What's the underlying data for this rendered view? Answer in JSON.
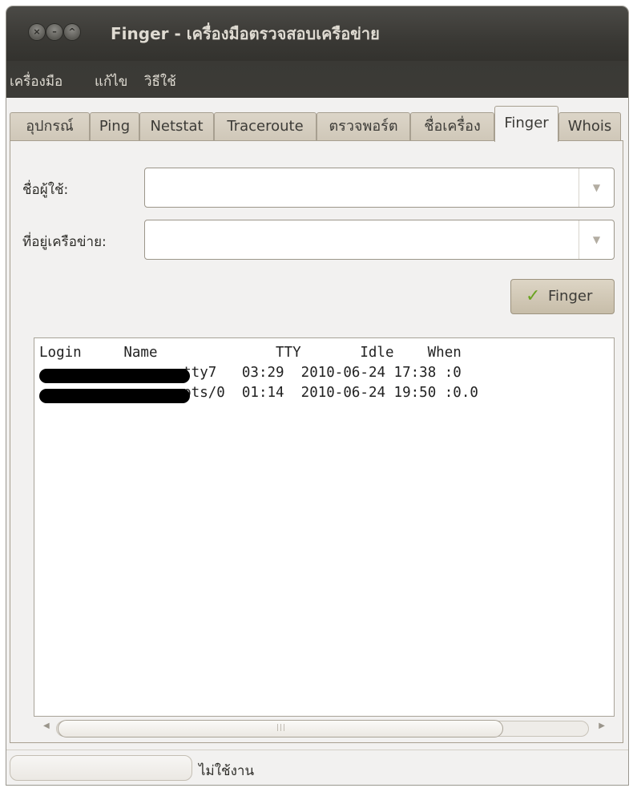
{
  "window": {
    "title": "Finger - เครื่องมือตรวจสอบเครือข่าย"
  },
  "menu": {
    "items": [
      "เครื่องมือ",
      "แก้ไข",
      "วิธีใช้"
    ]
  },
  "tabs": {
    "items": [
      "อุปกรณ์",
      "Ping",
      "Netstat",
      "Traceroute",
      "ตรวจพอร์ต",
      "ชื่อเครื่อง",
      "Finger",
      "Whois"
    ],
    "active": "Finger"
  },
  "form": {
    "username_label": "ชื่อผู้ใช้:",
    "username_value": "",
    "address_label": "ที่อยู่เครือข่าย:",
    "address_value": "",
    "finger_button": "Finger"
  },
  "output": {
    "header": "Login     Name              TTY       Idle    When",
    "rows": [
      {
        "tty": "tty7",
        "idle": "03:29",
        "when": "2010-06-24 17:38 :0"
      },
      {
        "tty": "pts/0",
        "idle": "01:14",
        "when": "2010-06-24 19:50 :0.0"
      }
    ]
  },
  "statusbar": {
    "text": "ไม่ใช้งาน"
  }
}
